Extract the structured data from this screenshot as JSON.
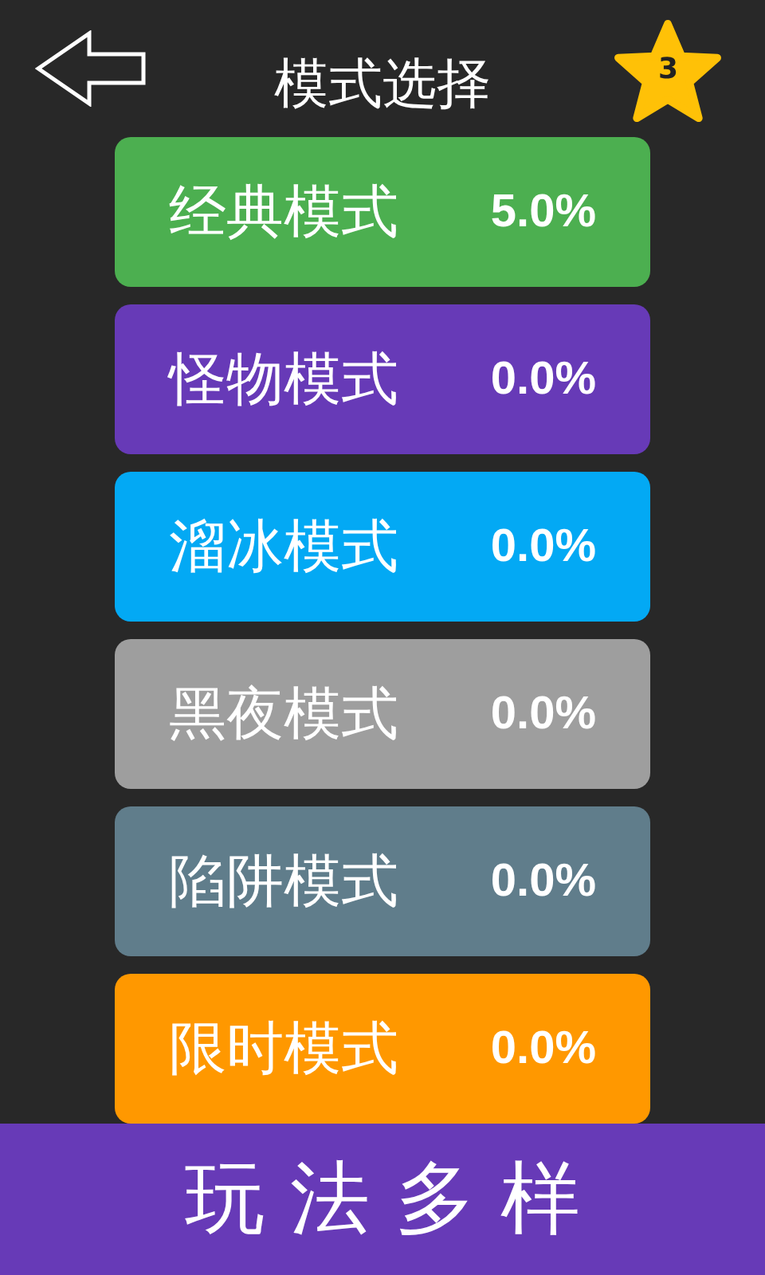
{
  "header": {
    "title": "模式选择",
    "star_count": "3"
  },
  "modes": [
    {
      "name": "经典模式",
      "percent": "5.0%",
      "color": "#4caf50"
    },
    {
      "name": "怪物模式",
      "percent": "0.0%",
      "color": "#673ab7"
    },
    {
      "name": "溜冰模式",
      "percent": "0.0%",
      "color": "#03a9f4"
    },
    {
      "name": "黑夜模式",
      "percent": "0.0%",
      "color": "#9e9e9e"
    },
    {
      "name": "陷阱模式",
      "percent": "0.0%",
      "color": "#607d8b"
    },
    {
      "name": "限时模式",
      "percent": "0.0%",
      "color": "#ff9800"
    }
  ],
  "banner": {
    "text": "玩 法 多 样"
  }
}
